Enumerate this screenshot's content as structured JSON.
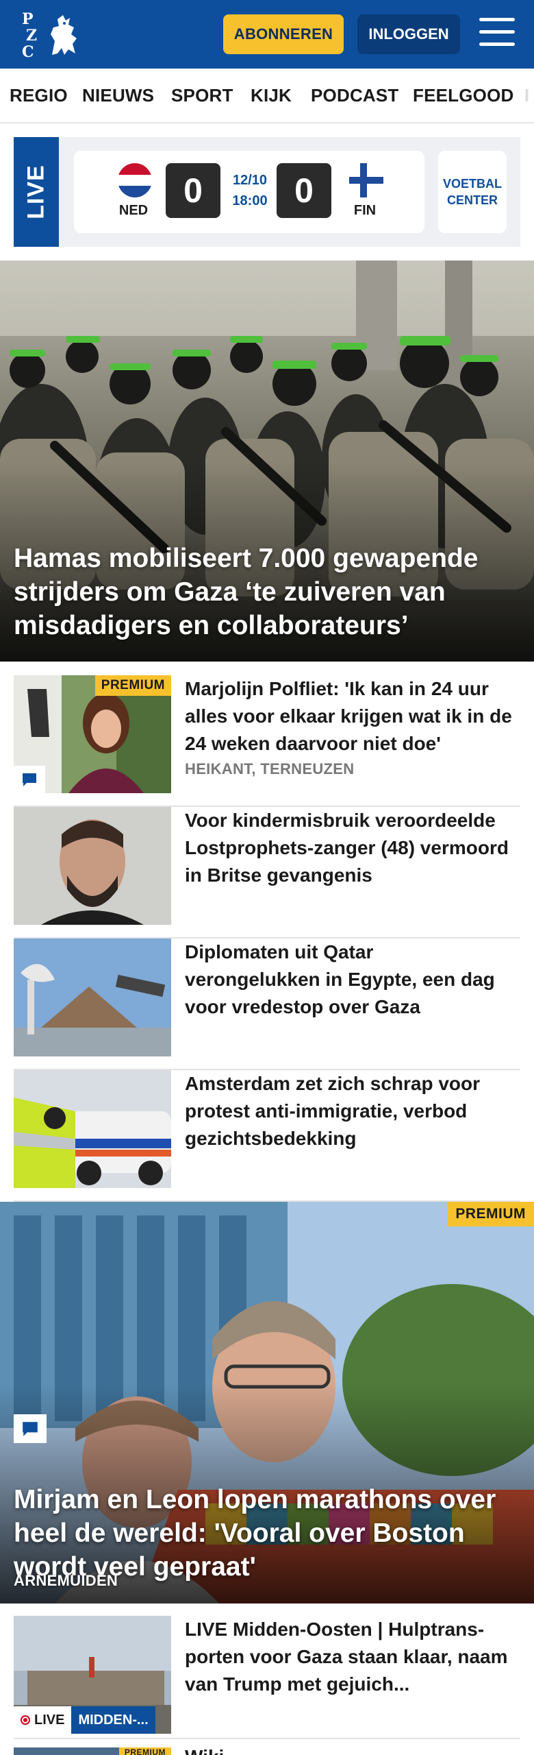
{
  "header": {
    "logo_text": "PZC",
    "subscribe_label": "ABONNEREN",
    "login_label": "INLOGGEN",
    "colors": {
      "brand": "#0d4f9c",
      "accent": "#f7c12e"
    }
  },
  "nav": {
    "items": [
      {
        "label": "REGIO"
      },
      {
        "label": "NIEUWS"
      },
      {
        "label": "SPORT"
      },
      {
        "label": "KIJK"
      },
      {
        "label": "PODCAST"
      },
      {
        "label": "FEELGOOD"
      },
      {
        "label": "I"
      }
    ]
  },
  "live": {
    "label": "LIVE",
    "home": {
      "code": "NED",
      "score": "0"
    },
    "away": {
      "code": "FIN",
      "score": "0"
    },
    "date": "12/10",
    "time": "18:00",
    "center_label": "VOETBAL CENTER"
  },
  "hero": {
    "title": "Hamas mobiliseert 7.000 gewapende strijders om Gaza ‘te zuiveren van misdadigers en collaborateurs’"
  },
  "articles": [
    {
      "title": "Marjolijn Polfliet: 'Ik kan in 24 uur alles voor elkaar krijgen wat ik in de 24 weken daarvoor niet doe'",
      "subtitle": "HEIKANT, TERNEUZEN",
      "badge": "PREMIUM"
    },
    {
      "title": "Voor kindermisbruik veroordeel­de Lostprophets-zanger (48) vermoord in Britse gevangenis"
    },
    {
      "title": "Diplomaten uit Qatar verongelukken in Egypte, een dag voor vredestop over Gaza"
    },
    {
      "title": "Amsterdam zet zich schrap voor protest anti-immigratie, verbod gezichtsbedekking"
    }
  ],
  "feature": {
    "badge": "PREMIUM",
    "title": "Mirjam en Leon lopen marathons over heel de wereld: 'Vooral over Boston wordt veel gepraat'",
    "subtitle": "ARNEMUIDEN"
  },
  "live_article": {
    "title": "LIVE Midden-Oosten | Hulptrans­porten voor Gaza staan klaar, naam van Trump met gejuich...",
    "badge_live": "LIVE",
    "badge_tag": "MIDDEN-...",
    "next_badge": "PREMIUM",
    "next_title": "Wiki..."
  }
}
